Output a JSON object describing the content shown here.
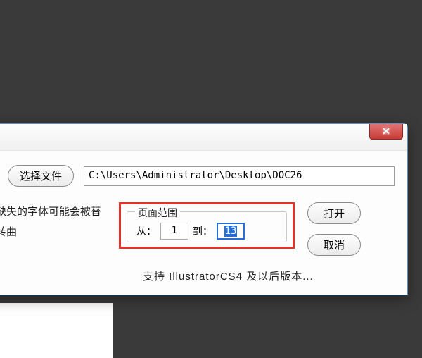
{
  "dialog": {
    "close_glyph": "✕",
    "select_file_label": "选择文件",
    "file_path": "C:\\Users\\Administrator\\Desktop\\DOC26",
    "left_text_line1": "中缺失的字体可能会被替",
    "left_text_line2": "字转曲",
    "range": {
      "legend": "页面范围",
      "from_label": "从：",
      "from_value": "1",
      "to_label": "到：",
      "to_value": "13"
    },
    "open_label": "打开",
    "cancel_label": "取消",
    "footer": "支持 IllustratorCS4 及以后版本..."
  }
}
